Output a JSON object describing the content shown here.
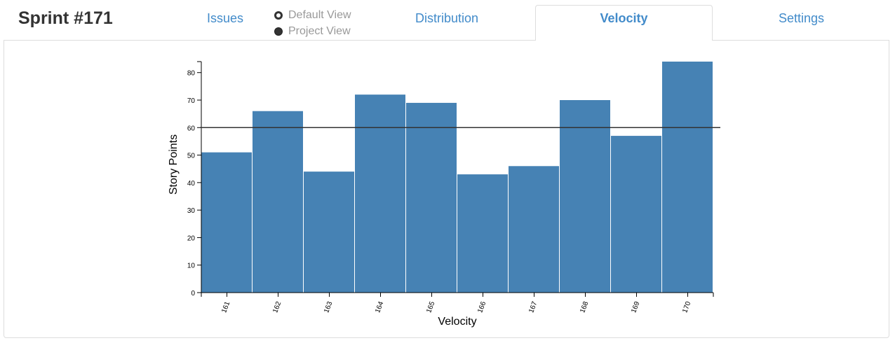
{
  "header": {
    "title": "Sprint #171"
  },
  "tabs": {
    "issues": "Issues",
    "distribution": "Distribution",
    "velocity": "Velocity",
    "settings": "Settings"
  },
  "view_options": {
    "default_view": "Default View",
    "project_view": "Project View",
    "selected": "Default View"
  },
  "colors": {
    "accent": "#428bca",
    "bar": "#4682b4",
    "average_line": "#333333"
  },
  "chart_data": {
    "type": "bar",
    "categories": [
      "161",
      "162",
      "163",
      "164",
      "165",
      "166",
      "167",
      "168",
      "169",
      "170"
    ],
    "values": [
      51,
      66,
      44,
      72,
      69,
      43,
      46,
      70,
      57,
      84
    ],
    "average_line": 60,
    "xlabel": "Velocity",
    "ylabel": "Story Points",
    "ylim": [
      0,
      84
    ],
    "yticks": [
      0,
      10,
      20,
      30,
      40,
      50,
      60,
      70,
      80
    ],
    "grid": false,
    "legend": "none"
  }
}
